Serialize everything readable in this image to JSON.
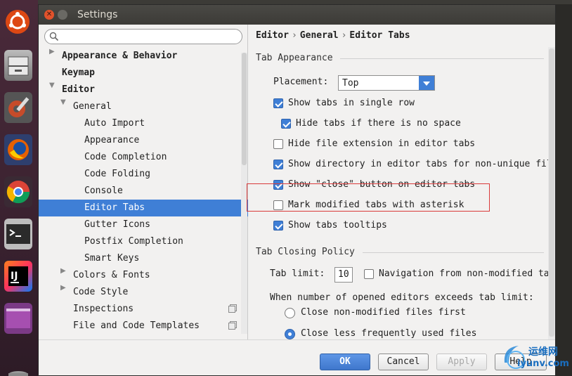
{
  "window": {
    "title": "Settings"
  },
  "search": {
    "placeholder": ""
  },
  "tree": {
    "items": [
      {
        "label": "Appearance & Behavior"
      },
      {
        "label": "Keymap"
      },
      {
        "label": "Editor"
      },
      {
        "label": "General"
      },
      {
        "label": "Auto Import"
      },
      {
        "label": "Appearance"
      },
      {
        "label": "Code Completion"
      },
      {
        "label": "Code Folding"
      },
      {
        "label": "Console"
      },
      {
        "label": "Editor Tabs"
      },
      {
        "label": "Gutter Icons"
      },
      {
        "label": "Postfix Completion"
      },
      {
        "label": "Smart Keys"
      },
      {
        "label": "Colors & Fonts"
      },
      {
        "label": "Code Style"
      },
      {
        "label": "Inspections"
      },
      {
        "label": "File and Code Templates"
      }
    ]
  },
  "breadcrumb": {
    "part1": "Editor",
    "part2": "General",
    "part3": "Editor Tabs",
    "separator": "›"
  },
  "tab_appearance": {
    "title": "Tab Appearance",
    "placement_label": "Placement:",
    "placement_value": "Top",
    "options": [
      {
        "label": "Show tabs in single row",
        "checked": true
      },
      {
        "label": "Hide tabs if there is no space",
        "checked": true
      },
      {
        "label": "Hide file extension in editor tabs",
        "checked": false
      },
      {
        "label": "Show directory in editor tabs for non-unique fil",
        "checked": true
      },
      {
        "label": "Show \"close\" button on editor tabs",
        "checked": true
      },
      {
        "label": "Mark modified tabs with asterisk",
        "checked": false
      },
      {
        "label": "Show tabs tooltips",
        "checked": true
      }
    ]
  },
  "tab_closing": {
    "title": "Tab Closing Policy",
    "limit_label": "Tab limit:",
    "limit_value": "10",
    "nav_label": "Navigation from non-modified tab",
    "exceeds_label": "When number of opened editors exceeds tab limit:",
    "radio1": "Close non-modified files first",
    "radio2": "Close less frequently used files"
  },
  "buttons": {
    "ok": "OK",
    "cancel": "Cancel",
    "apply": "Apply",
    "help": "Help"
  },
  "watermark": {
    "cn": "运维网",
    "en": "iyunv.com"
  }
}
